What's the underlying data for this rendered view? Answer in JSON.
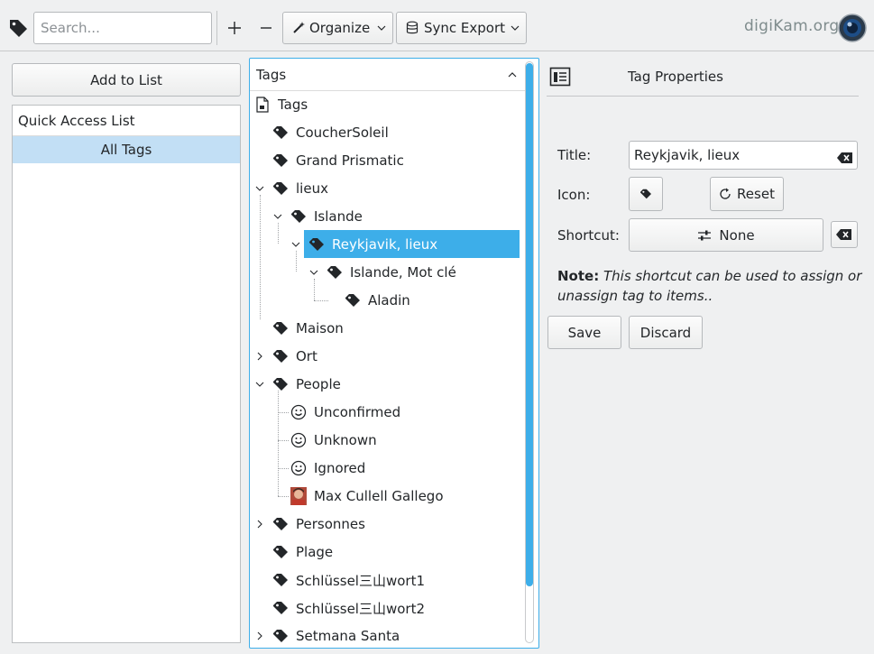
{
  "toolbar": {
    "search_placeholder": "Search...",
    "add_icon": "plus",
    "remove_icon": "minus",
    "organize_label": "Organize",
    "sync_export_label": "Sync Export",
    "brand_text": "digiKam.org"
  },
  "left": {
    "add_to_list_label": "Add to List",
    "quick_access_header": "Quick Access List",
    "items": [
      "All Tags"
    ]
  },
  "tree": {
    "header": "Tags",
    "root_label": "Tags",
    "items": [
      {
        "label": "CoucherSoleil",
        "icon": "tag-icon"
      },
      {
        "label": "Grand Prismatic",
        "icon": "tag-icon"
      },
      {
        "label": "lieux",
        "icon": "tag-icon",
        "expanded": true
      },
      {
        "label": "Islande",
        "icon": "tag-icon",
        "expanded": true
      },
      {
        "label": "Reykjavik, lieux",
        "icon": "tag-icon",
        "expanded": true,
        "selected": true
      },
      {
        "label": "Islande, Mot clé",
        "icon": "tag-icon",
        "expanded": true
      },
      {
        "label": "Aladin",
        "icon": "tag-icon"
      },
      {
        "label": "Maison",
        "icon": "tag-icon"
      },
      {
        "label": "Ort",
        "icon": "tag-icon",
        "expanded": false
      },
      {
        "label": "People",
        "icon": "tag-icon",
        "expanded": true
      },
      {
        "label": "Unconfirmed",
        "icon": "smiley-icon"
      },
      {
        "label": "Unknown",
        "icon": "smiley-icon"
      },
      {
        "label": "Ignored",
        "icon": "smiley-icon"
      },
      {
        "label": "Max Cullell Gallego",
        "icon": "face-thumbnail"
      },
      {
        "label": "Personnes",
        "icon": "tag-icon",
        "expanded": false
      },
      {
        "label": "Plage",
        "icon": "tag-icon"
      },
      {
        "label": "Schlüssel三山wort1",
        "icon": "tag-icon"
      },
      {
        "label": "Schlüssel三山wort2",
        "icon": "tag-icon"
      },
      {
        "label": "Setmana Santa",
        "icon": "tag-icon",
        "expanded": false
      }
    ]
  },
  "properties": {
    "header": "Tag Properties",
    "title_label": "Title:",
    "title_value": "Reykjavik, lieux",
    "icon_label": "Icon:",
    "reset_label": "Reset",
    "shortcut_label": "Shortcut:",
    "shortcut_value": "None",
    "note_bold": "Note:",
    "note_line1": "This shortcut can be used to assign or",
    "note_line2": "unassign tag to items..",
    "save_label": "Save",
    "discard_label": "Discard"
  },
  "colors": {
    "accent": "#3daee9",
    "selection_light": "#c2dff5",
    "background": "#eff0f1"
  }
}
